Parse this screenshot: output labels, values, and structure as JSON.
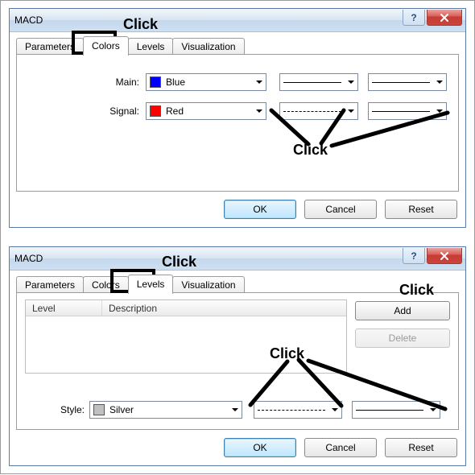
{
  "top": {
    "title": "MACD",
    "tabs": [
      "Parameters",
      "Colors",
      "Levels",
      "Visualization"
    ],
    "selected_tab": "Colors",
    "rows": {
      "main": {
        "label": "Main:",
        "color_name": "Blue",
        "color_hex": "#0000ff"
      },
      "signal": {
        "label": "Signal:",
        "color_name": "Red",
        "color_hex": "#ff0000"
      }
    },
    "buttons": {
      "ok": "OK",
      "cancel": "Cancel",
      "reset": "Reset"
    },
    "help_glyph": "?"
  },
  "bottom": {
    "title": "MACD",
    "tabs": [
      "Parameters",
      "Colors",
      "Levels",
      "Visualization"
    ],
    "selected_tab": "Levels",
    "headers": {
      "level": "Level",
      "description": "Description"
    },
    "side_buttons": {
      "add": "Add",
      "delete": "Delete"
    },
    "style": {
      "label": "Style:",
      "color_name": "Silver",
      "color_hex": "#c0c0c0"
    },
    "buttons": {
      "ok": "OK",
      "cancel": "Cancel",
      "reset": "Reset"
    },
    "help_glyph": "?"
  },
  "annotations": {
    "click": "Click"
  }
}
